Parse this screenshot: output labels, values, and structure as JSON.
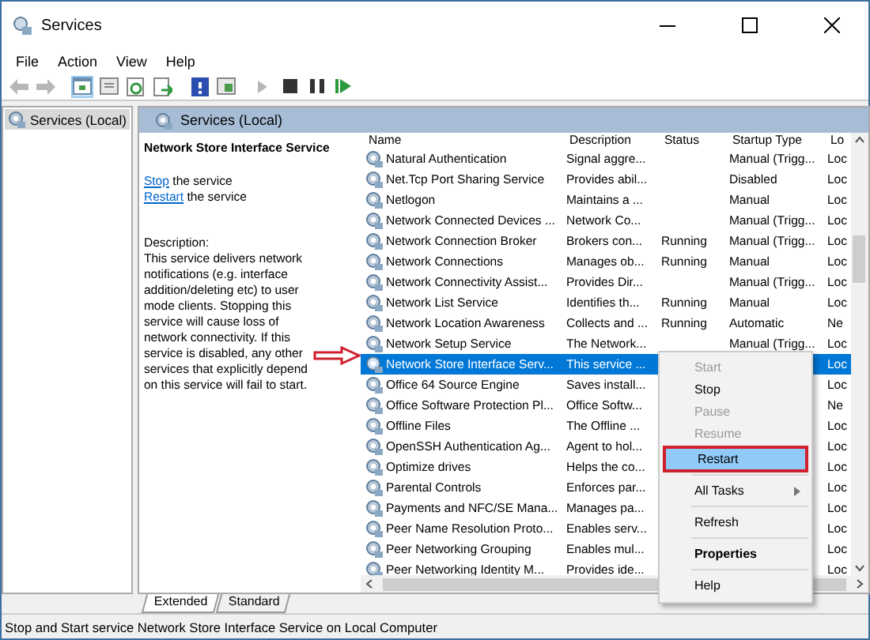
{
  "window": {
    "title": "Services"
  },
  "menu": [
    "File",
    "Action",
    "View",
    "Help"
  ],
  "toolbar": [
    {
      "kind": "back",
      "disabled": true
    },
    {
      "kind": "forward",
      "disabled": true
    },
    {
      "kind": "tree",
      "selected": true
    },
    {
      "kind": "sheet",
      "selected": false
    },
    {
      "kind": "refresh",
      "selected": false
    },
    {
      "kind": "export",
      "selected": false
    },
    {
      "kind": "help",
      "selected": false
    },
    {
      "kind": "panel",
      "selected": false
    },
    {
      "kind": "play",
      "disabled": true
    },
    {
      "kind": "stop",
      "disabled": false
    },
    {
      "kind": "pause",
      "disabled": false
    },
    {
      "kind": "resume",
      "disabled": false
    }
  ],
  "tree": [
    {
      "label": "Services (Local)",
      "selected": true
    }
  ],
  "pane_title": "Services (Local)",
  "detail": {
    "title": "Network Store Interface Service",
    "actions": [
      {
        "link": "Stop",
        "rest": "the service"
      },
      {
        "link": "Restart",
        "rest": "the service"
      }
    ],
    "description_label": "Description:",
    "description": "This service delivers network notifications (e.g. interface addition/deleting etc) to user mode clients. Stopping this service will cause loss of network connectivity. If this service is disabled, any other services that explicitly depend on this service will fail to start."
  },
  "table": {
    "columns": [
      "Name",
      "Description",
      "Status",
      "Startup Type",
      "Lo"
    ],
    "rows": [
      {
        "name": "Natural Authentication",
        "description": "Signal aggre...",
        "status": "",
        "startup": "Manual (Trigg...",
        "log": "Loc",
        "selected": false
      },
      {
        "name": "Net.Tcp Port Sharing Service",
        "description": "Provides abil...",
        "status": "",
        "startup": "Disabled",
        "log": "Loc",
        "selected": false
      },
      {
        "name": "Netlogon",
        "description": "Maintains a ...",
        "status": "",
        "startup": "Manual",
        "log": "Loc",
        "selected": false
      },
      {
        "name": "Network Connected Devices ...",
        "description": "Network Co...",
        "status": "",
        "startup": "Manual (Trigg...",
        "log": "Loc",
        "selected": false
      },
      {
        "name": "Network Connection Broker",
        "description": "Brokers con...",
        "status": "Running",
        "startup": "Manual (Trigg...",
        "log": "Loc",
        "selected": false
      },
      {
        "name": "Network Connections",
        "description": "Manages ob...",
        "status": "Running",
        "startup": "Manual",
        "log": "Loc",
        "selected": false
      },
      {
        "name": "Network Connectivity Assist...",
        "description": "Provides Dir...",
        "status": "",
        "startup": "Manual (Trigg...",
        "log": "Loc",
        "selected": false
      },
      {
        "name": "Network List Service",
        "description": "Identifies th...",
        "status": "Running",
        "startup": "Manual",
        "log": "Loc",
        "selected": false
      },
      {
        "name": "Network Location Awareness",
        "description": "Collects and ...",
        "status": "Running",
        "startup": "Automatic",
        "log": "Ne",
        "selected": false
      },
      {
        "name": "Network Setup Service",
        "description": "The Network...",
        "status": "",
        "startup": "Manual (Trigg...",
        "log": "Loc",
        "selected": false
      },
      {
        "name": "Network Store Interface Serv...",
        "description": "This service ...",
        "log": "Loc",
        "selected": true
      },
      {
        "name": "Office 64 Source Engine",
        "description": "Saves install...",
        "log": "Loc",
        "selected": false
      },
      {
        "name": "Office Software Protection Pl...",
        "description": "Office Softw...",
        "log": "Ne",
        "selected": false
      },
      {
        "name": "Offline Files",
        "description": "The Offline ...",
        "log": "Loc",
        "selected": false
      },
      {
        "name": "OpenSSH Authentication Ag...",
        "description": "Agent to hol...",
        "log": "Loc",
        "selected": false
      },
      {
        "name": "Optimize drives",
        "description": "Helps the co...",
        "log": "Loc",
        "selected": false
      },
      {
        "name": "Parental Controls",
        "description": "Enforces par...",
        "log": "Loc",
        "selected": false
      },
      {
        "name": "Payments and NFC/SE Mana...",
        "description": "Manages pa...",
        "log": "Loc",
        "selected": false
      },
      {
        "name": "Peer Name Resolution Proto...",
        "description": "Enables serv...",
        "log": "Loc",
        "selected": false
      },
      {
        "name": "Peer Networking Grouping",
        "description": "Enables mul...",
        "log": "Loc",
        "selected": false
      },
      {
        "name": "Peer Networking Identity M...",
        "description": "Provides ide...",
        "log": "Loc",
        "selected": false
      }
    ]
  },
  "context_menu": [
    {
      "kind": "item",
      "label": "Start",
      "disabled": true,
      "selected": false
    },
    {
      "kind": "item",
      "label": "Stop",
      "disabled": false,
      "selected": false
    },
    {
      "kind": "item",
      "label": "Pause",
      "disabled": true,
      "selected": false
    },
    {
      "kind": "item",
      "label": "Resume",
      "disabled": true,
      "selected": false
    },
    {
      "kind": "item",
      "label": "Restart",
      "disabled": false,
      "selected": true,
      "highlighted": true
    },
    {
      "kind": "submenu",
      "label": "All Tasks",
      "disabled": false,
      "selected": false
    },
    {
      "kind": "item",
      "label": "Refresh",
      "disabled": false,
      "selected": false
    },
    {
      "kind": "default",
      "label": "Properties",
      "disabled": false,
      "selected": false
    },
    {
      "kind": "item",
      "label": "Help",
      "disabled": false,
      "selected": false
    }
  ],
  "tabs": [
    {
      "label": "Extended",
      "selected": true
    },
    {
      "label": "Standard",
      "selected": false
    }
  ],
  "status_bar": "Stop and Start service Network Store Interface Service on Local Computer"
}
